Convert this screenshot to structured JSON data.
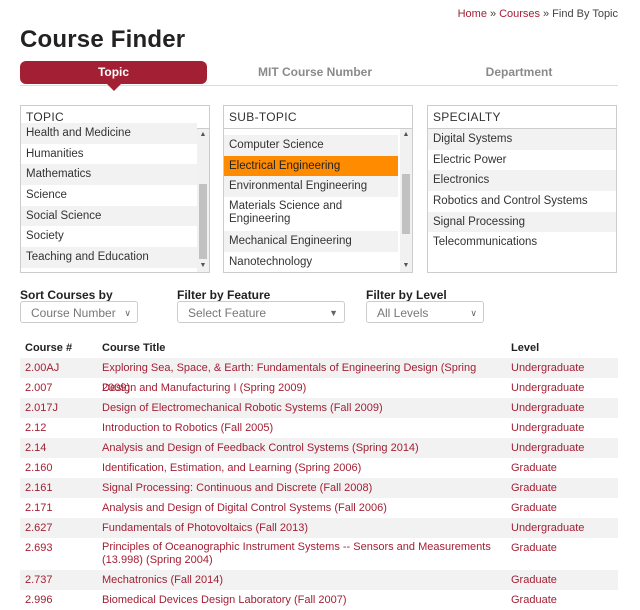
{
  "breadcrumb": {
    "items": [
      "Home",
      "Courses",
      "Find By Topic"
    ],
    "separator": "»"
  },
  "page_title": "Course Finder",
  "tabs": [
    {
      "label": "Topic",
      "active": true
    },
    {
      "label": "MIT Course Number",
      "active": false
    },
    {
      "label": "Department",
      "active": false
    }
  ],
  "topic": {
    "header": "TOPIC",
    "items": [
      "Health and Medicine",
      "Humanities",
      "Mathematics",
      "Science",
      "Social Science",
      "Society",
      "Teaching and Education"
    ]
  },
  "subtopic": {
    "header": "SUB-TOPIC",
    "items": [
      "Computer Science",
      "Electrical Engineering",
      "Environmental Engineering",
      "Materials Science and Engineering",
      "Mechanical Engineering",
      "Nanotechnology"
    ],
    "selected": "Electrical Engineering"
  },
  "specialty": {
    "header": "SPECIALTY",
    "items": [
      "Digital Systems",
      "Electric Power",
      "Electronics",
      "Robotics and Control Systems",
      "Signal Processing",
      "Telecommunications"
    ]
  },
  "filters": {
    "sort": {
      "label": "Sort Courses by",
      "value": "Course Number"
    },
    "feature": {
      "label": "Filter by Feature",
      "value": "Select Feature"
    },
    "level": {
      "label": "Filter by Level",
      "value": "All Levels"
    }
  },
  "table": {
    "headers": [
      "Course #",
      "Course Title",
      "Level"
    ],
    "rows": [
      {
        "num": "2.00AJ",
        "title": "Exploring Sea, Space, & Earth: Fundamentals of Engineering Design (Spring 2009)",
        "level": "Undergraduate"
      },
      {
        "num": "2.007",
        "title": "Design and Manufacturing I (Spring 2009)",
        "level": "Undergraduate"
      },
      {
        "num": "2.017J",
        "title": "Design of Electromechanical Robotic Systems (Fall 2009)",
        "level": "Undergraduate"
      },
      {
        "num": "2.12",
        "title": "Introduction to Robotics (Fall 2005)",
        "level": "Undergraduate"
      },
      {
        "num": "2.14",
        "title": "Analysis and Design of Feedback Control Systems (Spring 2014)",
        "level": "Undergraduate"
      },
      {
        "num": "2.160",
        "title": "Identification, Estimation, and Learning (Spring 2006)",
        "level": "Graduate"
      },
      {
        "num": "2.161",
        "title": "Signal Processing: Continuous and Discrete (Fall 2008)",
        "level": "Graduate"
      },
      {
        "num": "2.171",
        "title": "Analysis and Design of Digital Control Systems (Fall 2006)",
        "level": "Graduate"
      },
      {
        "num": "2.627",
        "title": "Fundamentals of Photovoltaics (Fall 2013)",
        "level": "Undergraduate"
      },
      {
        "num": "2.693",
        "title": "Principles of Oceanographic Instrument Systems -- Sensors and Measurements (13.998) (Spring 2004)",
        "level": "Graduate"
      },
      {
        "num": "2.737",
        "title": "Mechatronics (Fall 2014)",
        "level": "Graduate"
      },
      {
        "num": "2.996",
        "title": "Biomedical Devices Design Laboratory (Fall 2007)",
        "level": "Graduate"
      }
    ]
  },
  "colors": {
    "accent": "#a31f34",
    "selected": "#ff8c00"
  }
}
